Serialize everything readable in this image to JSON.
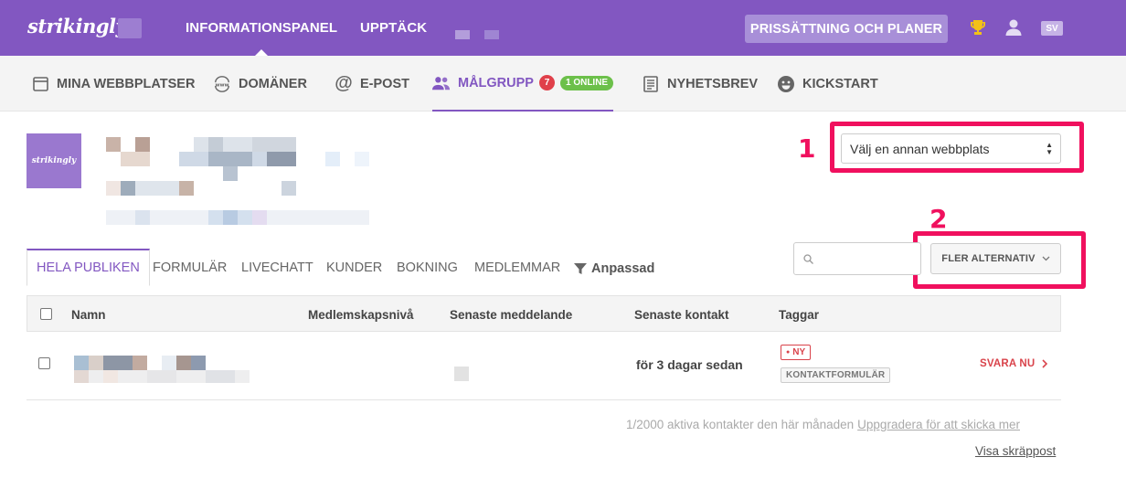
{
  "topbar": {
    "logo": "strikingly",
    "nav": [
      "INFORMATIONSPANEL",
      "UPPTÄCK"
    ],
    "pricing_button": "PRISSÄTTNING OCH PLANER",
    "language": "SV",
    "icons": [
      "trophy-icon",
      "user-icon"
    ]
  },
  "subnav": {
    "items": [
      {
        "label": "MINA WEBBPLATSER",
        "icon": "browser-window-icon"
      },
      {
        "label": "DOMÄNER",
        "icon": "www-globe-icon"
      },
      {
        "label": "E-POST",
        "icon": "at-sign-icon"
      },
      {
        "label": "MÅLGRUPP",
        "icon": "users-icon",
        "badge_count": "7",
        "online_badge": "1 ONLINE"
      },
      {
        "label": "NYHETSBREV",
        "icon": "newsletter-icon"
      },
      {
        "label": "KICKSTART",
        "icon": "smiley-icon"
      }
    ]
  },
  "site": {
    "thumb_logo": "strikingly",
    "selector_value": "Välj en annan webbplats"
  },
  "annotations": [
    "1",
    "2"
  ],
  "tabs": [
    "HELA PUBLIKEN",
    "FORMULÄR",
    "LIVECHATT",
    "KUNDER",
    "BOKNING",
    "MEDLEMMAR",
    "Anpassad"
  ],
  "more_options": "FLER ALTERNATIV",
  "table": {
    "headers": [
      "Namn",
      "Medlemskapsnivå",
      "Senaste meddelande",
      "Senaste kontakt",
      "Taggar"
    ],
    "rows": [
      {
        "last_contact": "för 3 dagar sedan",
        "tags": [
          "NY",
          "KONTAKTFORMULÄR"
        ],
        "action": "SVARA NU"
      }
    ]
  },
  "footer": {
    "usage": "1/2000 aktiva kontakter den här månaden",
    "upgrade_link": "Uppgradera för att skicka mer",
    "spam_link": "Visa skräppost"
  },
  "colors": {
    "brand": "#8257c1",
    "highlight": "#f0105e",
    "danger": "#d9434b",
    "online": "#6cc04a"
  }
}
